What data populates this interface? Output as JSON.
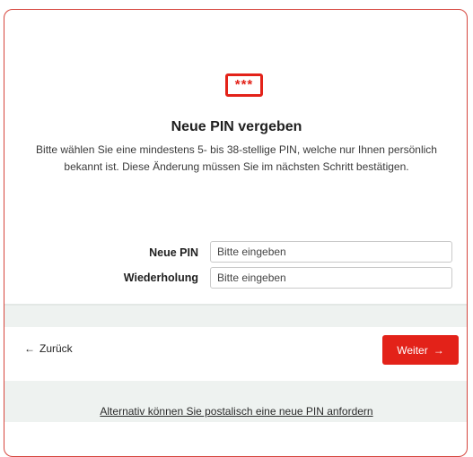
{
  "icon": {
    "name": "pin-asterisks-icon",
    "glyph": "***",
    "color": "#e32219"
  },
  "header": {
    "title": "Neue PIN vergeben",
    "description": "Bitte wählen Sie eine mindestens 5- bis 38-stellige PIN, welche nur Ihnen persönlich bekannt ist. Diese Änderung müssen Sie im nächsten Schritt bestätigen."
  },
  "form": {
    "new_pin": {
      "label": "Neue PIN",
      "value": "",
      "placeholder": "Bitte eingeben"
    },
    "repeat": {
      "label": "Wiederholung",
      "value": "",
      "placeholder": "Bitte eingeben"
    }
  },
  "navigation": {
    "back_arrow": "←",
    "back_label": "Zurück",
    "next_label": "Weiter",
    "next_arrow": "→",
    "accent_color": "#e32219"
  },
  "footer": {
    "alt_link": "Alternativ können Sie postalisch eine neue PIN anfordern"
  }
}
